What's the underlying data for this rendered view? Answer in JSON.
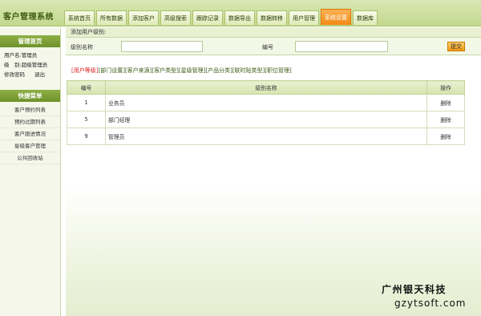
{
  "app_title": "客户管理系统",
  "nav": [
    {
      "label": "系统首页"
    },
    {
      "label": "所有数据"
    },
    {
      "label": "添加客户"
    },
    {
      "label": "高级搜索"
    },
    {
      "label": "跟踪记录"
    },
    {
      "label": "数据导出"
    },
    {
      "label": "数据转移"
    },
    {
      "label": "用户管理"
    },
    {
      "label": "系统设置",
      "active": true
    },
    {
      "label": "数据库"
    }
  ],
  "sidebar": {
    "section1_title": "管理首页",
    "username_line": "用户名:管理员",
    "level_line": "级　别:超级管理员",
    "change_password": "修改密码",
    "logout": "退出",
    "section2_title": "快捷菜单",
    "menu": [
      "客户预约列表",
      "预约过期列表",
      "客户跟进情况",
      "星级客户管理",
      "公共回收站"
    ]
  },
  "main": {
    "subtitle": "添加用户级别:",
    "form": {
      "level_name_label": "级别名称",
      "level_name_value": "",
      "number_label": "编号",
      "number_value": "",
      "submit_label": "提交"
    },
    "sublinks": [
      "[用户等级]",
      "[部门设置]",
      "[客户来源]",
      "[客户类型]",
      "[星级管理]",
      "[产品分类]",
      "[联时贴类型]",
      "[职位管理]"
    ],
    "table": {
      "headers": [
        "编号",
        "级别名称",
        "操作"
      ],
      "rows": [
        {
          "num": "1",
          "name": "业务员",
          "action": "删除"
        },
        {
          "num": "5",
          "name": "部门经理",
          "action": "删除"
        },
        {
          "num": "9",
          "name": "管理员",
          "action": "删除"
        }
      ]
    }
  },
  "watermark": {
    "line1": "广州银天科技",
    "line2": "gzytsoft.com"
  }
}
